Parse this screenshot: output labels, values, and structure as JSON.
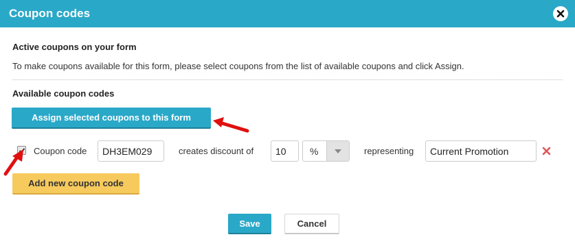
{
  "dialog": {
    "title": "Coupon codes",
    "close_icon": "close-icon"
  },
  "active": {
    "heading": "Active coupons on your form",
    "description": "To make coupons available for this form, please select coupons from the list of available coupons and click Assign."
  },
  "available": {
    "heading": "Available coupon codes",
    "assign_button": "Assign selected coupons to this form",
    "coupon_row": {
      "checked": true,
      "code_label": "Coupon code",
      "code_value": "DH3EM029",
      "discount_label": "creates discount of",
      "discount_value": "10",
      "discount_type": "%",
      "representing_label": "representing",
      "representing_value": "Current Promotion",
      "remove_icon": "remove-icon"
    },
    "add_button": "Add new coupon code"
  },
  "footer": {
    "save_button": "Save",
    "cancel_button": "Cancel"
  },
  "colors": {
    "accent": "#2aa8c8",
    "add_button": "#f7ca5e",
    "remove_icon": "#e05555",
    "annotation_arrow": "#e01010"
  }
}
